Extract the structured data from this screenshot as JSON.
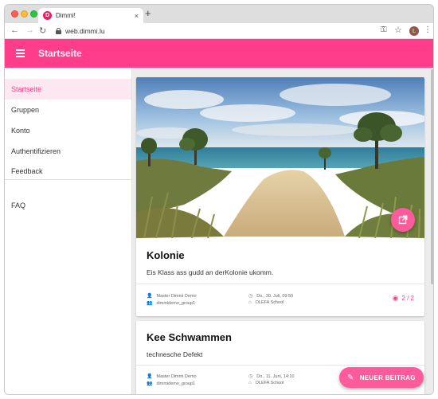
{
  "browser": {
    "tab_title": "Dimmi!",
    "tab_favicon": "D",
    "tab_close": "×",
    "new_tab": "+",
    "url": "web.dimmi.lu",
    "profile_initial": "L"
  },
  "appbar": {
    "title": "Startseite",
    "color": "#ff3d8b"
  },
  "sidebar": {
    "items": [
      {
        "label": "Startseite",
        "active": true
      },
      {
        "label": "Gruppen"
      },
      {
        "label": "Konto"
      },
      {
        "label": "Authentifizieren"
      },
      {
        "label": "Feedback"
      }
    ],
    "secondary": [
      {
        "label": "FAQ"
      }
    ]
  },
  "posts": [
    {
      "title": "Kolonie",
      "description": "Eis Klass ass gudd an derKolonie ukomm.",
      "author": "Master Dimmi Demo",
      "group": "dimmidemo_group1",
      "date": "Do., 30. Juli, 09:50",
      "school": "OLEFA School",
      "views": "2 / 2",
      "image_icon": "open-in-new-icon"
    },
    {
      "title": "Kee Schwammen",
      "description": "technesche Defekt",
      "author": "Master Dimmi Demo",
      "group": "dimmidemo_group1",
      "date": "Do., 11. Juni, 14:10",
      "school": "OLEFA School"
    }
  ],
  "actions": {
    "new_post_label": "NEUER BEITRAG"
  }
}
